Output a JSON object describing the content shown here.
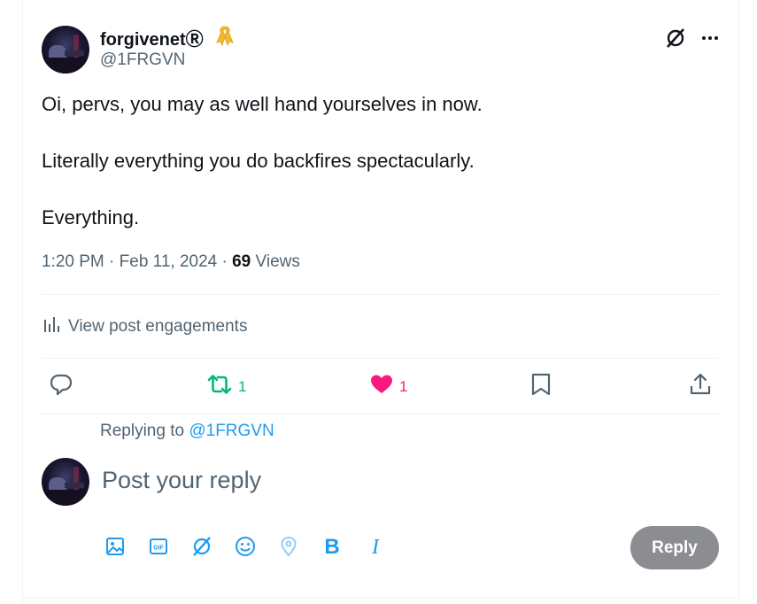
{
  "author": {
    "name": "forgivenetⓇ",
    "handle": "@1FRGVN",
    "avatar_icon": "avatar-photo",
    "badge_icon": "ribbon-icon"
  },
  "tweet": {
    "lines": [
      "Oi, pervs, you may as well hand yourselves in now.",
      "Literally everything you do backfires spectacularly.",
      "Everything."
    ],
    "time": "1:20 PM · Feb 11, 2024 · ",
    "views_count": "69",
    "views_label": " Views"
  },
  "engagements": {
    "label": "View post engagements"
  },
  "actions": {
    "reply_count": "",
    "retweet_count": "1",
    "like_count": "1"
  },
  "reply_section": {
    "replying_prefix": "Replying to ",
    "replying_handle": "@1FRGVN",
    "placeholder": "Post your reply",
    "reply_button": "Reply"
  },
  "colors": {
    "accent": "#1d9bf0",
    "retweet": "#00ba7c",
    "like": "#f91880",
    "muted": "#536471",
    "button_disabled": "#8b8d90"
  }
}
